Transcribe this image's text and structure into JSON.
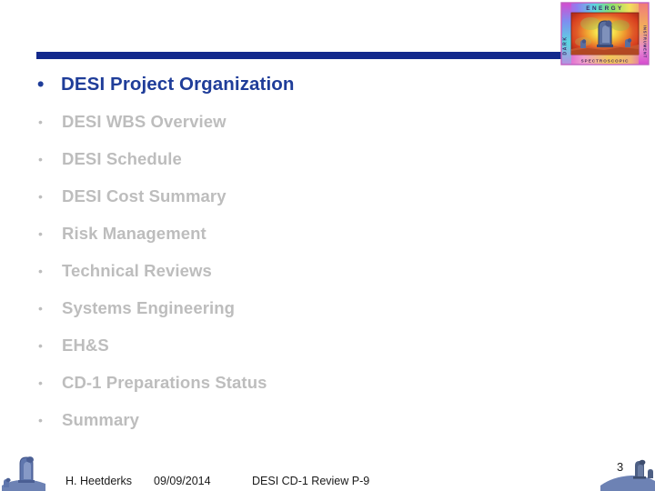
{
  "slide": {
    "page_number": "3",
    "accent_color": "#13298c",
    "active_text_color": "#1f3d99",
    "dim_text_color": "#bdbdbd",
    "background_color": "#ffffff"
  },
  "logo": {
    "name": "doe-seal",
    "ring_text_top": "ENERGY",
    "ring_text_left": "DARK",
    "ring_text_right": "INSTRUMENT",
    "ring_text_bottom": "SPECTROSCOPIC"
  },
  "agenda": {
    "items": [
      {
        "label": "DESI Project Organization",
        "level": 1,
        "bullet": "•"
      },
      {
        "label": "DESI WBS Overview",
        "level": 2,
        "bullet": "•"
      },
      {
        "label": "DESI Schedule",
        "level": 2,
        "bullet": "•"
      },
      {
        "label": "DESI Cost Summary",
        "level": 2,
        "bullet": "•"
      },
      {
        "label": "Risk Management",
        "level": 2,
        "bullet": "•"
      },
      {
        "label": "Technical Reviews",
        "level": 2,
        "bullet": "•"
      },
      {
        "label": "Systems Engineering",
        "level": 2,
        "bullet": "•"
      },
      {
        "label": "EH&S",
        "level": 2,
        "bullet": "•"
      },
      {
        "label": "CD-1 Preparations Status",
        "level": 2,
        "bullet": "•"
      },
      {
        "label": "Summary",
        "level": 2,
        "bullet": "•"
      }
    ]
  },
  "footer": {
    "author": "H. Heetderks",
    "date": "09/09/2014",
    "title": "DESI CD-1 Review  P-9"
  }
}
